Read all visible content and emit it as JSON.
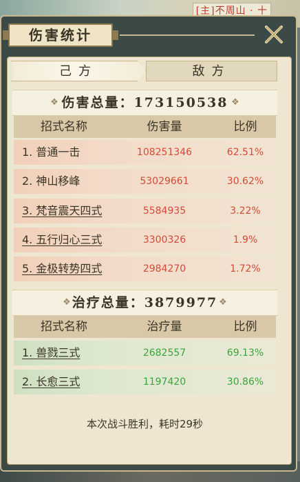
{
  "background": {
    "top_right_text": "[主]不周山 · 十"
  },
  "window": {
    "title": "伤害统计"
  },
  "tabs": [
    {
      "label": "己方",
      "active": true
    },
    {
      "label": "敌方",
      "active": false
    }
  ],
  "damage": {
    "title": "伤害总量：173150538",
    "headers": [
      "招式名称",
      "伤害量",
      "比例"
    ],
    "rows": [
      {
        "name": "1. 普通一击",
        "value": "108251346",
        "percent": "62.51%"
      },
      {
        "name": "2. 神山移峰",
        "value": "53029661",
        "percent": "30.62%"
      },
      {
        "name": "3. 梵音震天四式",
        "value": "5584935",
        "percent": "3.22%"
      },
      {
        "name": "4. 五行归心三式",
        "value": "3300326",
        "percent": "1.9%"
      },
      {
        "name": "5. 金极转势四式",
        "value": "2984270",
        "percent": "1.72%"
      }
    ]
  },
  "healing": {
    "title": "治疗总量：3879977",
    "headers": [
      "招式名称",
      "治疗量",
      "比例"
    ],
    "rows": [
      {
        "name": "1. 兽戮三式",
        "value": "2682557",
        "percent": "69.13%"
      },
      {
        "name": "2. 长愈三式",
        "value": "1197420",
        "percent": "30.86%"
      }
    ]
  },
  "footer": {
    "text": "本次战斗胜利，耗时29秒"
  },
  "colors": {
    "damage_text": "#d44a35",
    "heal_text": "#3aa33a",
    "panel_bg": "#efe6d2",
    "frame_border": "#c9b98f"
  }
}
